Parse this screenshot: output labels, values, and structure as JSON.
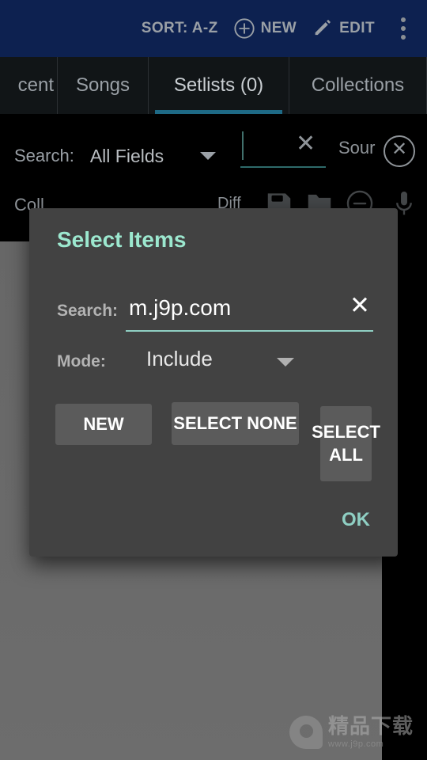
{
  "topbar": {
    "sort_label": "SORT: A-Z",
    "new_label": "NEW",
    "new_icon": "plus-circle-icon",
    "edit_label": "EDIT",
    "edit_icon": "pencil-icon",
    "overflow_icon": "kebab-menu-icon",
    "background_color": "#0d2150"
  },
  "tabs": {
    "items": [
      {
        "label": "cent",
        "active": false
      },
      {
        "label": "Songs",
        "active": false
      },
      {
        "label": "Setlists (0)",
        "active": true
      },
      {
        "label": "Collections",
        "active": false
      }
    ],
    "active_index": 2,
    "indicator_color": "#1e6a86"
  },
  "search_bar": {
    "label": "Search:",
    "field_select_value": "All Fields",
    "field_select_caret": "chevron-down-icon",
    "query_value": "",
    "query_placeholder": "",
    "clear_icon": "close-x-icon",
    "source_label": "Sour",
    "close_icon": "close-circle-icon"
  },
  "toolbar_row": {
    "collections_label": "Coll",
    "diff_label": "Diff",
    "icons": [
      "save-icon",
      "folder-icon",
      "circle-minus-icon",
      "microphone-icon"
    ]
  },
  "dialog": {
    "title": "Select Items",
    "title_color": "#9ce8cf",
    "background_color": "#424242",
    "search_label": "Search:",
    "search_value": "m.j9p.com",
    "search_clear_icon": "close-x-icon",
    "search_underline_color": "#8fcfc3",
    "mode_label": "Mode:",
    "mode_value": "Include",
    "mode_caret": "chevron-down-icon",
    "buttons": {
      "new": "NEW",
      "select_none": "SELECT NONE",
      "select_all": "SELECT ALL",
      "ok": "OK"
    },
    "button_color": "#5b5b5b",
    "ok_color": "#8fcfc3"
  },
  "watermark": {
    "main": "精品下载",
    "sub": "www.j9p.com",
    "logo_icon": "j9p-logo-icon"
  }
}
